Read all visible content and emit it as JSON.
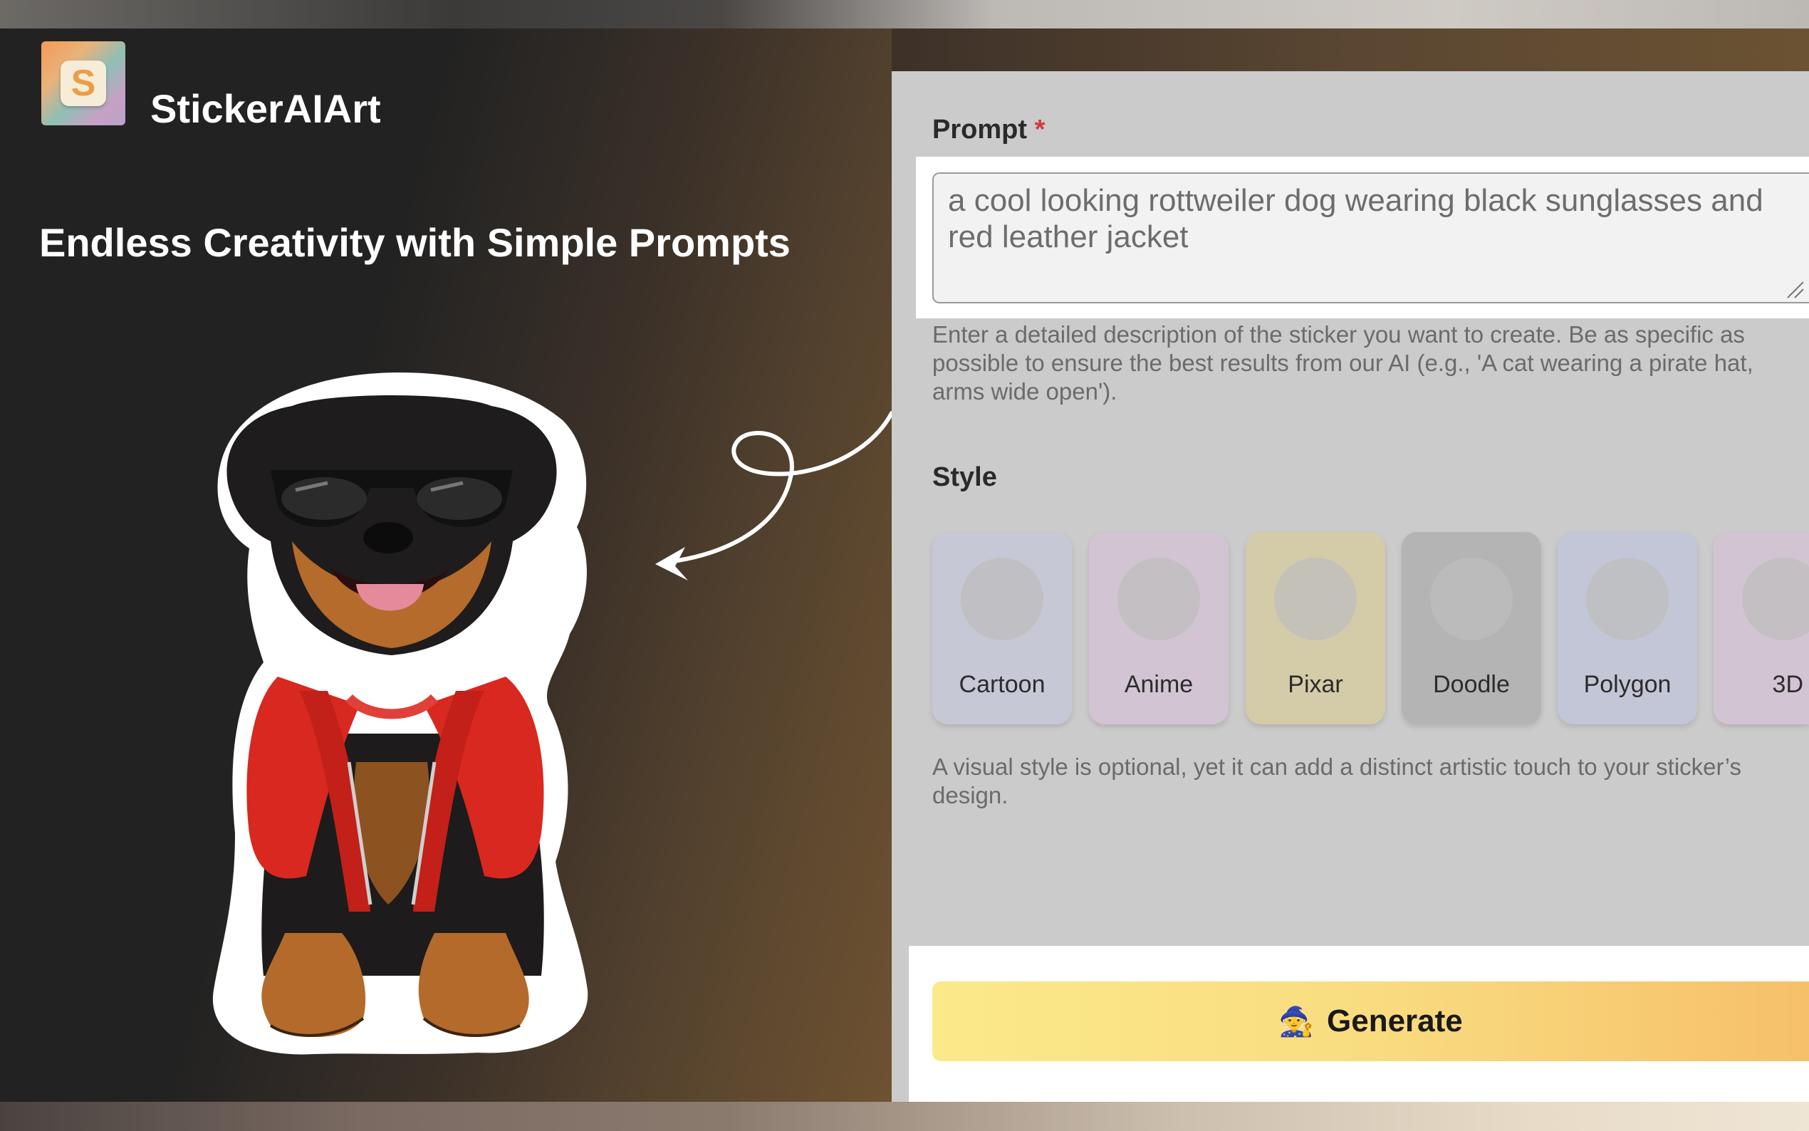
{
  "brand": {
    "name": "StickerAIArt",
    "logo_letter": "S"
  },
  "hero": {
    "tagline": "Endless Creativity with Simple Prompts"
  },
  "form": {
    "prompt": {
      "label": "Prompt",
      "required_mark": "*",
      "value": "a cool looking rottweiler dog wearing black sunglasses and red leather jacket",
      "help": "Enter a detailed description of the sticker you want to create. Be as specific as possible to ensure the best results from our AI (e.g., 'A cat wearing a pirate hat, arms wide open')."
    },
    "style": {
      "label": "Style",
      "options": [
        {
          "name": "Cartoon",
          "color": "#c6c8d6"
        },
        {
          "name": "Anime",
          "color": "#d2c4d2"
        },
        {
          "name": "Pixar",
          "color": "#d4cca8"
        },
        {
          "name": "Doodle",
          "color": "#b4b4b4"
        },
        {
          "name": "Polygon",
          "color": "#c3c6d6"
        },
        {
          "name": "3D",
          "color": "#d3c4d3"
        }
      ],
      "help": "A visual style is optional, yet it can add a distinct artistic touch to your sticker’s design."
    },
    "generate": {
      "label": "Generate",
      "icon": "wizard-icon"
    }
  },
  "colors": {
    "accent_start": "#fbe98a",
    "accent_end": "#f6c06a",
    "required": "#d43b3b"
  }
}
